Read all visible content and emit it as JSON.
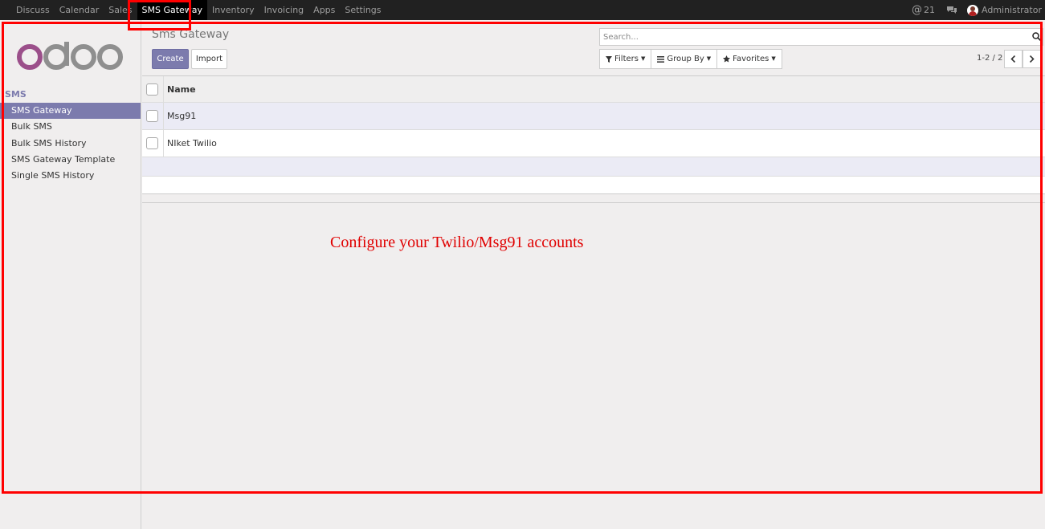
{
  "topbar": {
    "menu": [
      "Discuss",
      "Calendar",
      "Sales",
      "SMS Gateway",
      "Inventory",
      "Invoicing",
      "Apps",
      "Settings"
    ],
    "active_index": 3,
    "mention_count": "21",
    "user_name": "Administrator"
  },
  "sidebar": {
    "logo_text": "odoo",
    "section": "SMS",
    "items": [
      "SMS Gateway",
      "Bulk SMS",
      "Bulk SMS History",
      "SMS Gateway Template",
      "Single SMS History"
    ],
    "active_index": 0
  },
  "control_panel": {
    "breadcrumb": "Sms Gateway",
    "create_label": "Create",
    "import_label": "Import",
    "search_placeholder": "Search...",
    "filters_label": "Filters",
    "group_by_label": "Group By",
    "favorites_label": "Favorites",
    "pager_text": "1-2 / 2"
  },
  "list": {
    "column_name": "Name",
    "rows": [
      "Msg91",
      "NIket Twilio"
    ]
  },
  "annotation": {
    "note": "Configure your Twilio/Msg91 accounts",
    "color": "#ff0000"
  },
  "colors": {
    "brand": "#7c7bad",
    "topbar": "#212121"
  },
  "icons": [
    "search-icon",
    "filter-icon",
    "group-by-icon",
    "star-icon",
    "chevron-left-icon",
    "chevron-right-icon",
    "at-icon",
    "chat-icon",
    "avatar"
  ]
}
